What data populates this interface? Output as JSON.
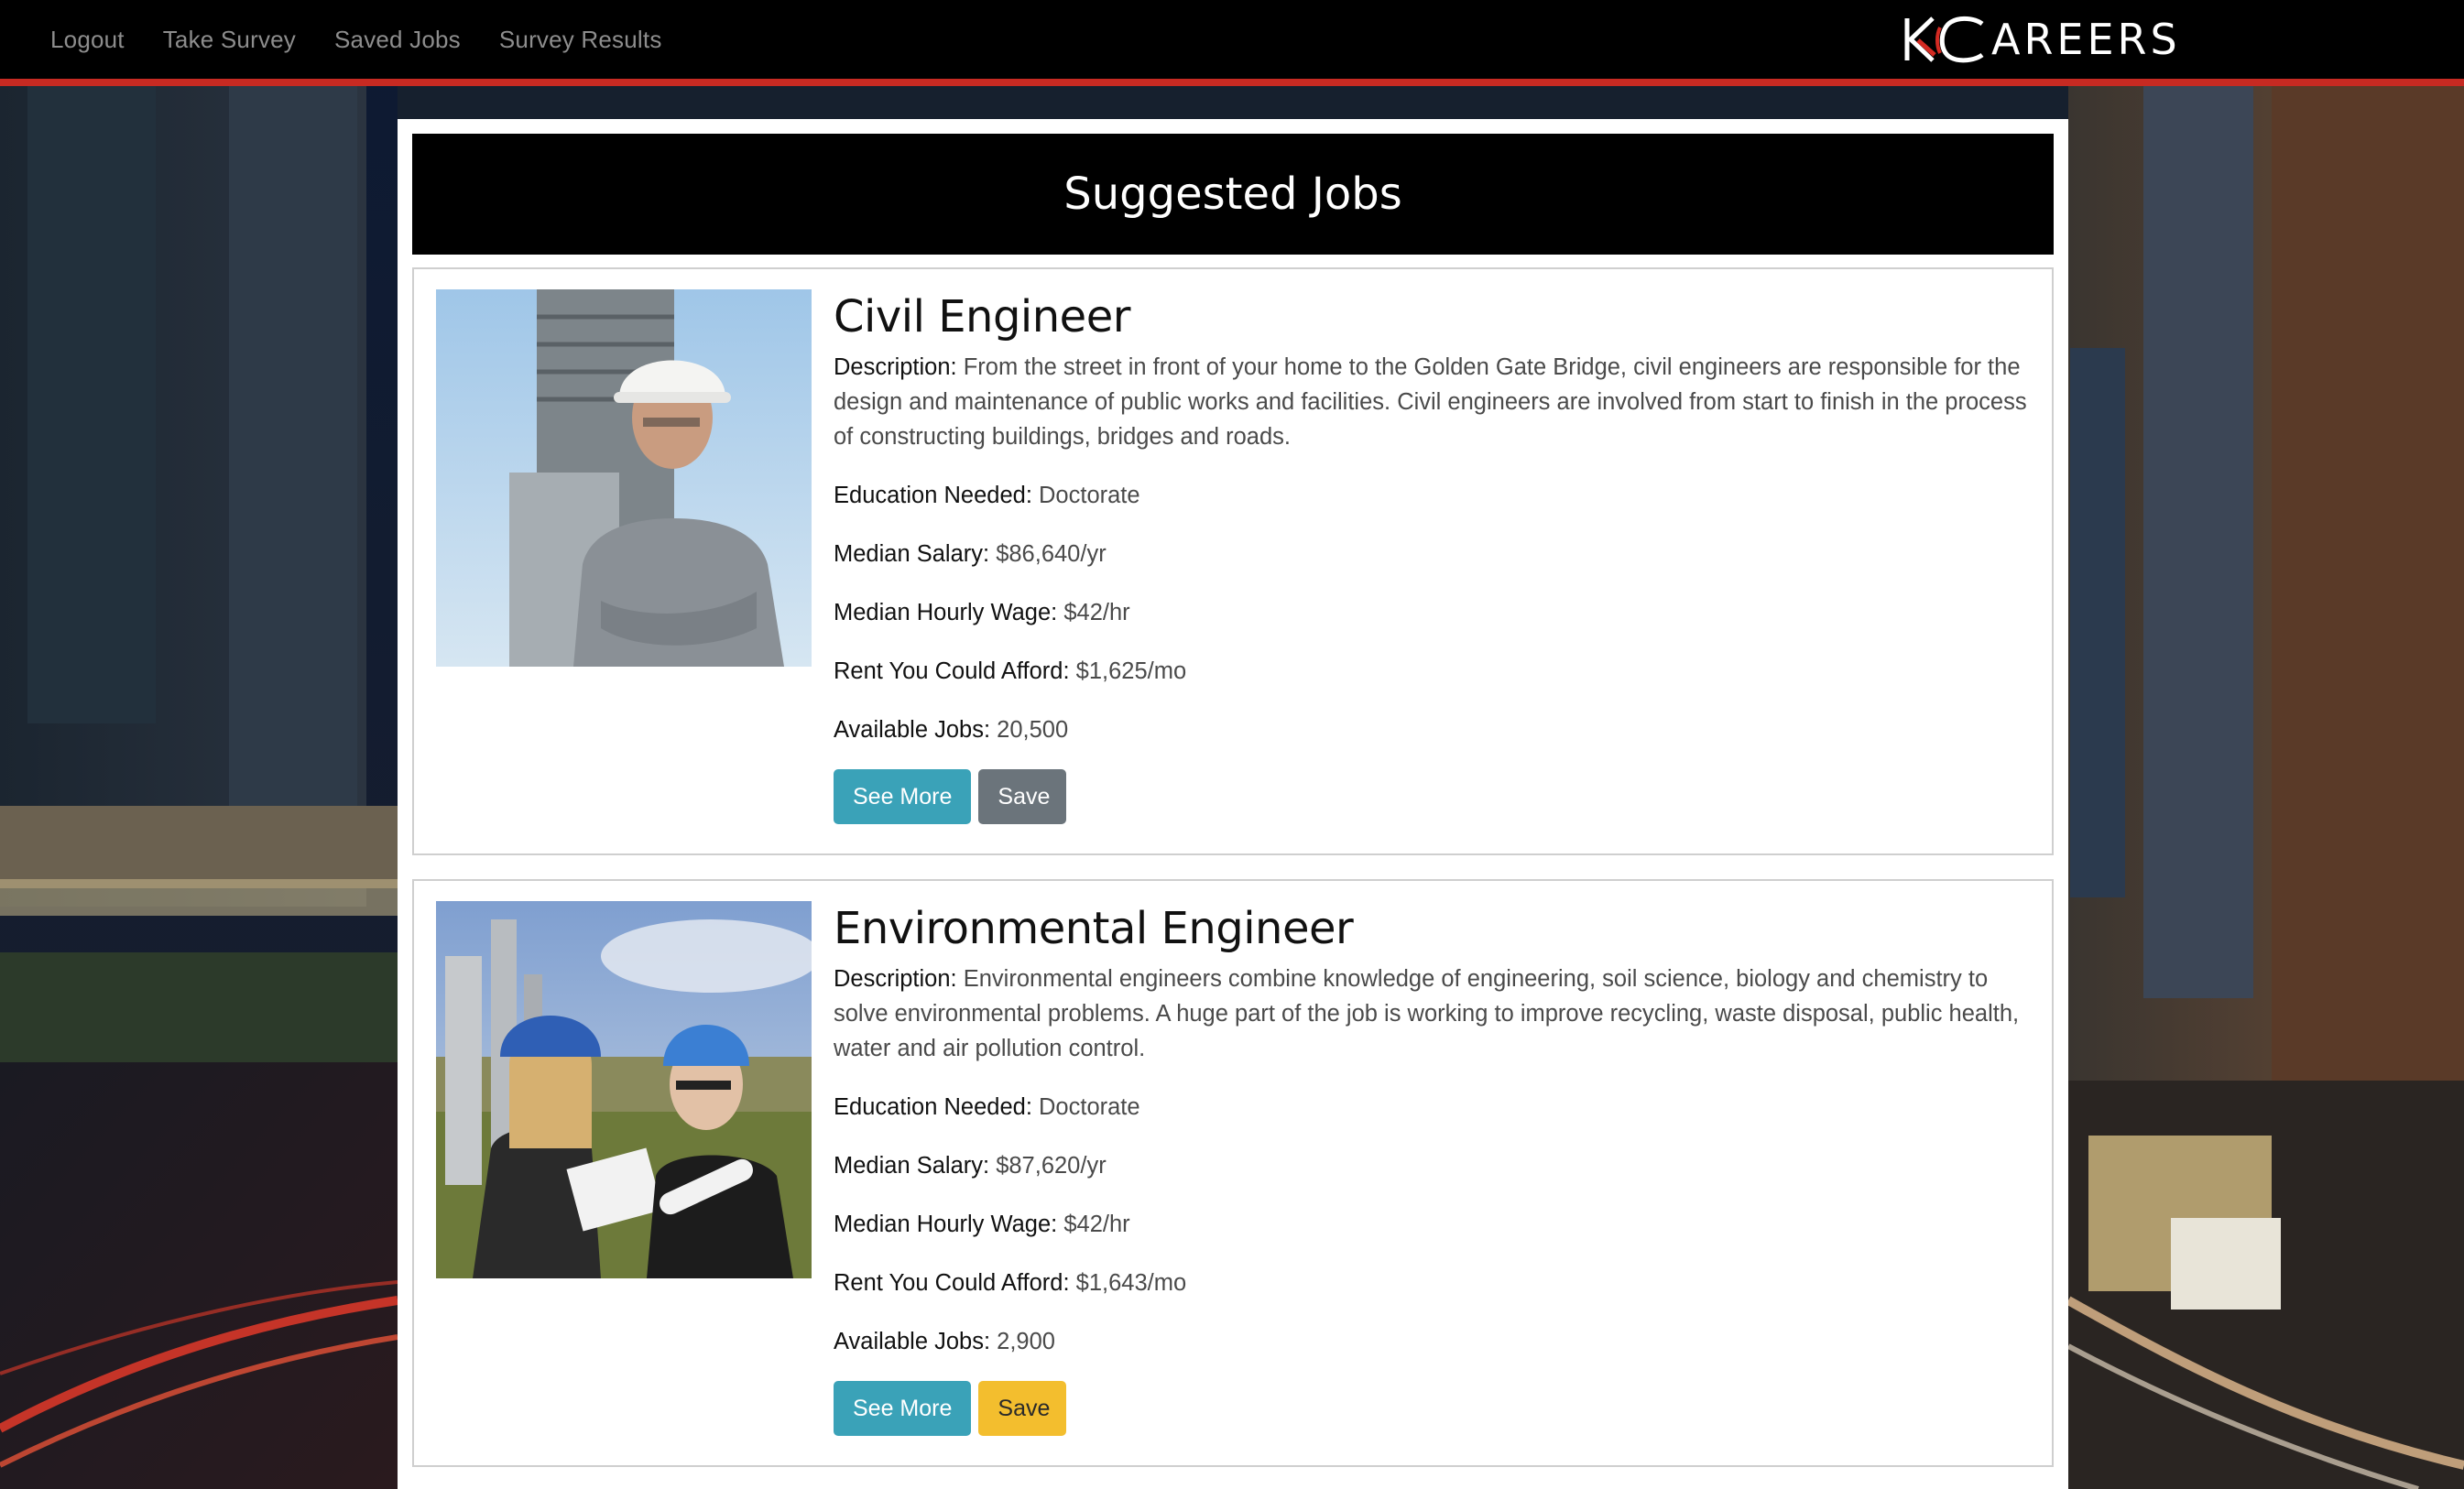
{
  "nav": {
    "links": [
      "Logout",
      "Take Survey",
      "Saved Jobs",
      "Survey Results"
    ],
    "brand_suffix": "AREERS",
    "brand_mark": "KC-logo"
  },
  "page": {
    "title": "Suggested Jobs"
  },
  "labels": {
    "description": "Description:",
    "education": "Education Needed:",
    "salary": "Median Salary:",
    "hourly": "Median Hourly Wage:",
    "rent": "Rent You Could Afford:",
    "available": "Available Jobs:",
    "see_more": "See More",
    "save": "Save"
  },
  "jobs": [
    {
      "title": "Civil Engineer",
      "description": "From the street in front of your home to the Golden Gate Bridge, civil engineers are responsible for the design and maintenance of public works and facilities. Civil engineers are involved from start to finish in the process of constructing buildings, bridges and roads.",
      "education": "Doctorate",
      "salary": "$86,640/yr",
      "hourly": "$42/hr",
      "rent": "$1,625/mo",
      "available": "20,500",
      "save_state": "unsaved"
    },
    {
      "title": "Environmental Engineer",
      "description": "Environmental engineers combine knowledge of engineering, soil science, biology and chemistry to solve environmental problems. A huge part of the job is working to improve recycling, waste disposal, public health, water and air pollution control.",
      "education": "Doctorate",
      "salary": "$87,620/yr",
      "hourly": "$42/hr",
      "rent": "$1,643/mo",
      "available": "2,900",
      "save_state": "saved"
    }
  ],
  "colors": {
    "nav_bg": "#000000",
    "nav_accent": "#c72a22",
    "see_more": "#3aa2b8",
    "save_default": "#6b747b",
    "save_saved": "#f3be2e"
  }
}
